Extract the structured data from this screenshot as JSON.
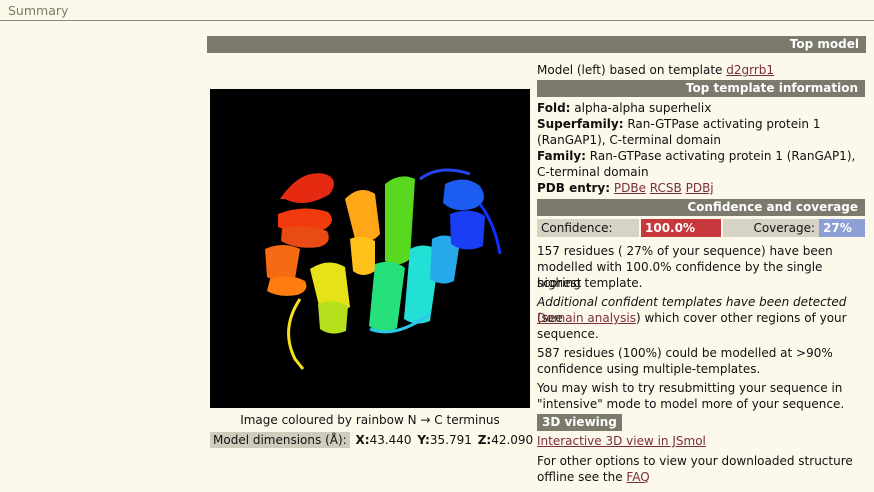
{
  "summary_title": "Summary",
  "top_model_bar": "Top model",
  "model_line": {
    "prefix": "Model (left) based on template",
    "template_link": "d2grrb1"
  },
  "top_template_bar": "Top template information",
  "fold": {
    "label": "Fold:",
    "value": "alpha-alpha superhelix"
  },
  "superfamily": {
    "label": "Superfamily:",
    "value_line1": "Ran-GTPase activating protein 1",
    "value_line2": "(RanGAP1), C-terminal domain"
  },
  "family": {
    "label": "Family:",
    "value_line1": "Ran-GTPase activating protein 1 (RanGAP1),",
    "value_line2": "C-terminal domain"
  },
  "pdb_entry": {
    "label": "PDB entry:",
    "links": [
      "PDBe",
      "RCSB",
      "PDBj"
    ]
  },
  "confidence_bar": "Confidence and coverage",
  "confidence": {
    "label": "Confidence:",
    "value": "100.0%",
    "value_fraction": 1.0
  },
  "coverage": {
    "label": "Coverage:",
    "value": "27%",
    "value_fraction": 0.27
  },
  "residues_text": [
    "157 residues ( 27% of your sequence) have been",
    "modelled with 100.0% confidence by the single highest",
    "scoring template."
  ],
  "additional": {
    "italic": "Additional confident templates have been detected",
    "after_italic": " (see",
    "link": "Domain analysis",
    "after_link": ") which cover other regions of your",
    "line3": "sequence."
  },
  "multi_text": [
    "587 residues (100%) could be modelled at >90%",
    "confidence using multiple-templates."
  ],
  "resubmit_text": [
    "You may wish to try resubmitting your sequence in",
    "\"intensive\" mode to model more of your sequence."
  ],
  "viewing_tag": "3D viewing",
  "jsmol_link": "Interactive 3D view in JSmol",
  "offline_text": {
    "line1": "For other options to view your downloaded structure",
    "line2_prefix": "offline see the ",
    "faq_link": "FAQ"
  },
  "image_caption": "Image coloured by rainbow N → C terminus",
  "dimensions": {
    "label": "Model dimensions (Å):",
    "x_label": "X:",
    "x": "43.440",
    "y_label": "Y:",
    "y": "35.791",
    "z_label": "Z:",
    "z": "42.090"
  },
  "colors": {
    "bar": "#7b7a6c",
    "confidence": "#c8373b",
    "coverage": "#8e9fd6",
    "link": "#7a2e39",
    "background": "#fcf9ea"
  }
}
